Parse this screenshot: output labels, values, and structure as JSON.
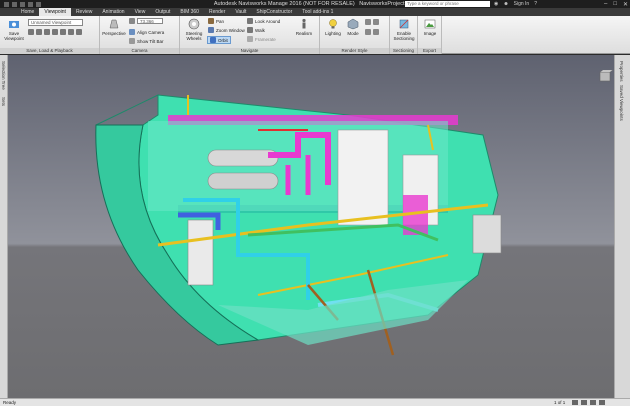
{
  "window": {
    "app_title": "Autodesk Navisworks Manage 2016 (NOT FOR RESALE)",
    "file_name": "NavisworksProject.nwd",
    "search_placeholder": "Type a keyword or phrase",
    "sign_in": "Sign In"
  },
  "ribbon_tabs": [
    {
      "label": "Home",
      "active": false
    },
    {
      "label": "Viewpoint",
      "active": true
    },
    {
      "label": "Review",
      "active": false
    },
    {
      "label": "Animation",
      "active": false
    },
    {
      "label": "View",
      "active": false
    },
    {
      "label": "Output",
      "active": false
    },
    {
      "label": "BIM 360",
      "active": false
    },
    {
      "label": "Render",
      "active": false
    },
    {
      "label": "Vault",
      "active": false
    },
    {
      "label": "ShipConstructor",
      "active": false
    },
    {
      "label": "Tool add-ins 1",
      "active": false
    }
  ],
  "panels": {
    "save_load": {
      "label": "Save, Load & Playback",
      "save_viewpoint": "Save Viewpoint",
      "viewpoint_combo": "Unnamed Viewpoint"
    },
    "camera": {
      "label": "Camera",
      "perspective": "Perspective",
      "align_camera": "Align Camera",
      "show_tilt_bar": "Show Tilt Bar",
      "fov_value": "73.366"
    },
    "navigate": {
      "label": "Navigate",
      "steering_wheels": "Steering Wheels",
      "pan": "Pan",
      "zoom_window": "Zoom Window",
      "orbit": "Orbit",
      "look_around": "Look Around",
      "walk": "Walk",
      "realism": "Realism",
      "framerate": "Framerate"
    },
    "render_style": {
      "label": "Render Style",
      "lighting": "Lighting",
      "mode": "Mode"
    },
    "sectioning": {
      "label": "Sectioning",
      "enable": "Enable Sectioning"
    },
    "export": {
      "label": "Export",
      "image": "Image"
    }
  },
  "left_dock": {
    "tabs": [
      "Selection Tree",
      "Sets"
    ]
  },
  "right_dock": {
    "tabs": [
      "Properties",
      "Saved Viewpoints"
    ]
  },
  "status": {
    "text": "Ready",
    "page": "1 of 1"
  },
  "colors": {
    "hull": "#3fe0b0",
    "deck_pink": "#e83ad0",
    "machinery": "#f0f0f0",
    "pipe_yellow": "#e8c020",
    "pipe_cyan": "#30d0e8",
    "pipe_blue": "#4060e0"
  }
}
